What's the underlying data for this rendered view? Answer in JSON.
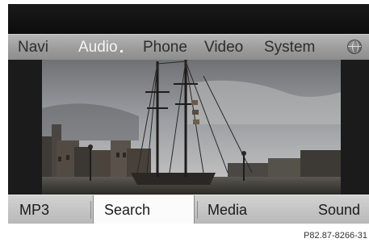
{
  "menu": {
    "items": [
      {
        "label": "Navi",
        "active": false
      },
      {
        "label": "Audio",
        "active": true
      },
      {
        "label": "Phone",
        "active": false
      },
      {
        "label": "Video",
        "active": false
      },
      {
        "label": "System",
        "active": false
      }
    ],
    "globe_icon": "globe-icon"
  },
  "content": {
    "image_subject": "harbor-with-sailing-ship-masts"
  },
  "softkeys": {
    "items": [
      {
        "label": "MP3",
        "selected": false
      },
      {
        "label": "Search",
        "selected": true
      },
      {
        "label": "Media",
        "selected": false
      },
      {
        "label": "Sound",
        "selected": false
      }
    ]
  },
  "figure_ref": "P82.87-8266-31",
  "colors": {
    "menubar": "#a6a6a6",
    "active_menu_text": "#f4f4f4",
    "menu_text": "#2d2d2d",
    "softkey_bar": "#c6c6c6",
    "selected_softkey": "#fbfbfb"
  }
}
